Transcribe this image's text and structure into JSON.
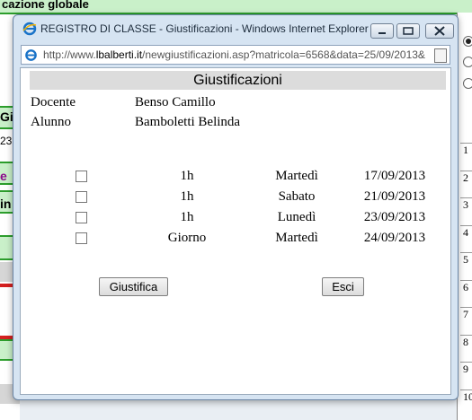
{
  "background": {
    "top_fragment": "cazione globale",
    "frag_gi": "Gi",
    "frag_23": "23",
    "frag_e": "e",
    "frag_in": "in",
    "row_numbers": [
      "1",
      "2",
      "3",
      "4",
      "5",
      "6",
      "7",
      "8",
      "9",
      "10"
    ]
  },
  "window": {
    "title": "REGISTRO DI CLASSE - Giustificazioni - Windows Internet Explorer",
    "url_prefix": "http://www.",
    "url_domain": "lbalberti.it",
    "url_rest": "/newgiustificazioni.asp?matricola=6568&data=25/09/2013&"
  },
  "page": {
    "header": "Giustificazioni",
    "docente_label": "Docente",
    "docente_value": "Benso Camillo",
    "alunno_label": "Alunno",
    "alunno_value": "Bamboletti Belinda",
    "rows": [
      {
        "amount": "1h",
        "day": "Martedì",
        "date": "17/09/2013",
        "checked": false
      },
      {
        "amount": "1h",
        "day": "Sabato",
        "date": "21/09/2013",
        "checked": false
      },
      {
        "amount": "1h",
        "day": "Lunedì",
        "date": "23/09/2013",
        "checked": false
      },
      {
        "amount": "Giorno",
        "day": "Martedì",
        "date": "24/09/2013",
        "checked": false
      }
    ],
    "justify_button": "Giustifica",
    "exit_button": "Esci"
  }
}
